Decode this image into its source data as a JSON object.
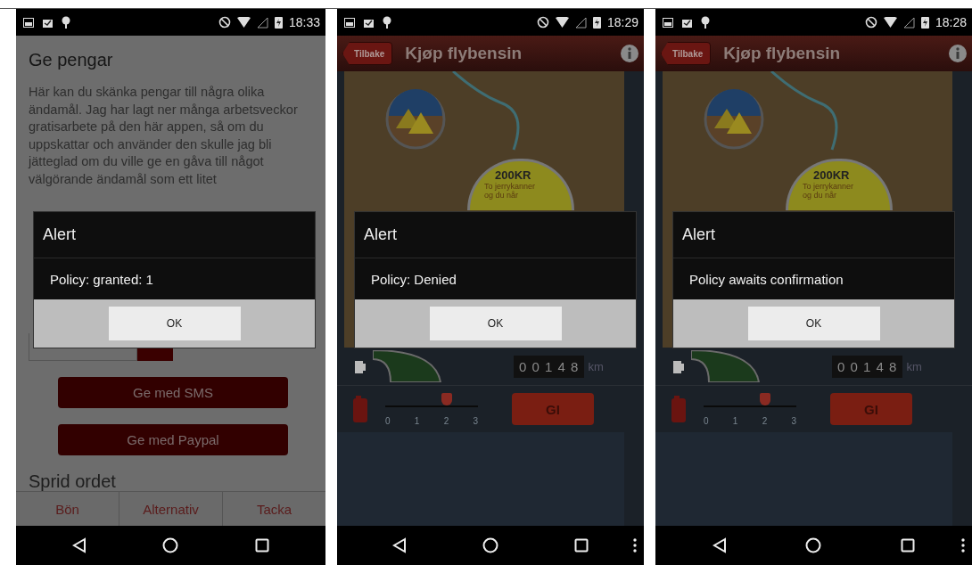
{
  "phones": [
    {
      "kind": "donate",
      "status_bar": {
        "time": "18:33"
      },
      "nav": {
        "menu_dots": false
      },
      "page": {
        "title": "Ge pengar",
        "body": "Här kan du skänka pengar till några olika ändamål. Jag har lagt ner många arbetsveckor gratisarbete på den här appen, så om du uppskattar och använder den skulle jag bli jätteglad om du ville ge en gåva till något välgörande ändamål som ett litet",
        "buttons": [
          "Ge med SMS",
          "Ge med Paypal"
        ],
        "section_heading": "Sprid ordet",
        "tabs": [
          "Bön",
          "Alternativ",
          "Tacka"
        ]
      },
      "dialog": {
        "title": "Alert",
        "message": "Policy: granted: 1",
        "button": "OK"
      }
    },
    {
      "kind": "fuel",
      "status_bar": {
        "time": "18:29"
      },
      "nav": {
        "menu_dots": true
      },
      "page": {
        "back": "Tilbake",
        "title": "Kjøp flybensin",
        "bubble": {
          "price": "200KR",
          "lines": [
            "To jerrykanner",
            "og du når"
          ]
        },
        "odometer": {
          "digits": "0 0 1 4 8",
          "unit": "km"
        },
        "slider": {
          "level": 0.667,
          "labels": [
            "0",
            "1",
            "2",
            "3"
          ]
        },
        "button": "GI"
      },
      "dialog": {
        "title": "Alert",
        "message": "Policy: Denied",
        "button": "OK"
      }
    },
    {
      "kind": "fuel",
      "status_bar": {
        "time": "18:28"
      },
      "nav": {
        "menu_dots": true
      },
      "page": {
        "back": "Tilbake",
        "title": "Kjøp flybensin",
        "bubble": {
          "price": "200KR",
          "lines": [
            "To jerrykanner",
            "og du når"
          ]
        },
        "odometer": {
          "digits": "0 0 1 4 8",
          "unit": "km"
        },
        "slider": {
          "level": 0.667,
          "labels": [
            "0",
            "1",
            "2",
            "3"
          ]
        },
        "button": "GI"
      },
      "dialog": {
        "title": "Alert",
        "message": "Policy awaits confirmation",
        "button": "OK"
      }
    }
  ]
}
